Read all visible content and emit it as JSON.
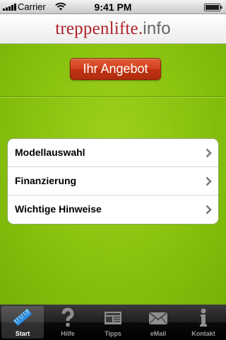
{
  "status_bar": {
    "carrier": "Carrier",
    "time": "9:41 PM"
  },
  "header": {
    "logo_main": "treppenlifte.",
    "logo_tld": "info"
  },
  "offer_button": {
    "label": "Ihr Angebot"
  },
  "menu": {
    "items": [
      {
        "label": "Modellauswahl"
      },
      {
        "label": "Finanzierung"
      },
      {
        "label": "Wichtige Hinweise"
      }
    ]
  },
  "tab_bar": {
    "items": [
      {
        "label": "Start",
        "icon": "ruler-icon",
        "active": true
      },
      {
        "label": "Hilfe",
        "icon": "question-mark-icon",
        "active": false
      },
      {
        "label": "Tipps",
        "icon": "newspaper-icon",
        "active": false
      },
      {
        "label": "eMail",
        "icon": "envelope-icon",
        "active": false
      },
      {
        "label": "Kontakt",
        "icon": "info-icon",
        "active": false
      }
    ]
  },
  "colors": {
    "brand_red": "#b0232b",
    "background_green": "#88c10f",
    "button_red": "#d2401c"
  }
}
